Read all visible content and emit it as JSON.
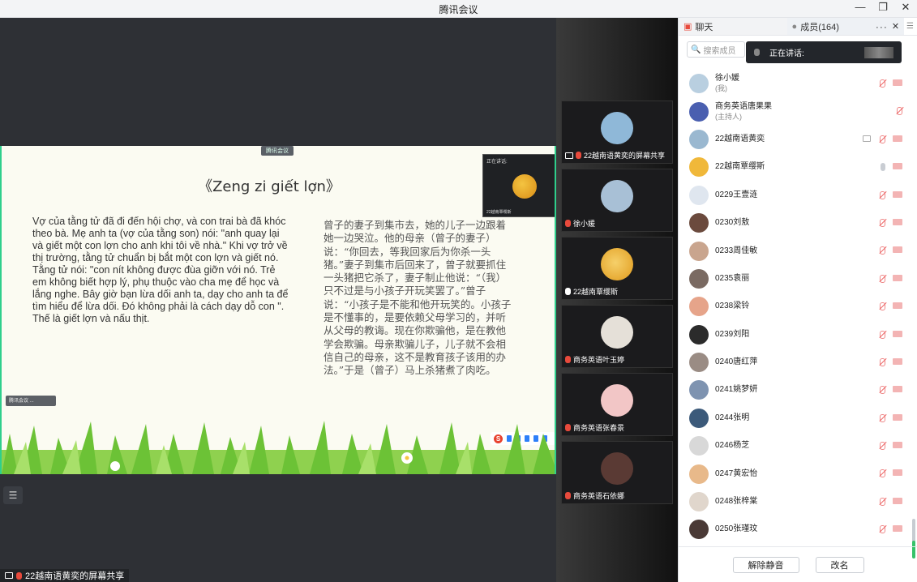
{
  "window": {
    "title": "腾讯会议"
  },
  "slide": {
    "tag": "腾讯会议",
    "title": "《Zeng zi giết lợn》",
    "vietnamese": "  Vợ của tằng tử đã đi đến hội chợ, và con trai bà đã khóc theo bà. Mẹ anh ta (vợ của tằng son) nói: \"anh quay lại và giết một con lợn cho anh khi tôi về nhà.\" Khi vợ trở về thị trường, tằng tử chuẩn bị bắt một con lợn và giết nó.\n  Tằng tử nói: \"con nít không được đùa giỡn với nó. Trẻ em không biết hợp lý, phụ thuộc vào cha mẹ để học và lắng nghe. Bây giờ bạn lừa dối anh ta, dạy cho anh ta để tìm hiểu để lừa dối. Đó không phải là cách dạy dỗ con \". Thế là giết lợn và nấu thịt.",
    "chinese": "曾子的妻子到集市去，她的儿子一边跟着她一边哭泣。他的母亲（曾子的妻子）说：“你回去，等我回家后为你杀一头猪。”妻子到集市后回来了，曾子就要抓住一头猪把它杀了，妻子制止他说：“（我）只不过是与小孩子开玩笑罢了。”曾子说：“小孩子是不能和他开玩笑的。小孩子是不懂事的，是要依赖父母学习的，并听从父母的教诲。现在你欺骗他，是在教他学会欺骗。母亲欺骗儿子，儿子就不会相信自己的母亲，这不是教育孩子该用的办法。”于是（曾子）马上杀猪煮了肉吃。",
    "speaker_label": "正在讲话:",
    "speaker_name": "22越南覃缨斯",
    "toolbar_label": "腾讯会议 ...",
    "ime_label": "S"
  },
  "stage": {
    "share_caption": "22越南语黄奕的屏幕共享"
  },
  "tiles": [
    {
      "caption": "22越南语黄奕的屏幕共享",
      "mic": "off",
      "screen": true,
      "color": "#8fb8d8"
    },
    {
      "caption": "徐小媛",
      "mic": "off",
      "screen": false,
      "color": "#a8c0d6"
    },
    {
      "caption": "22越南覃缨斯",
      "mic": "on",
      "screen": false,
      "color": "#f0b83a"
    },
    {
      "caption": "商务英语叶玉婷",
      "mic": "off",
      "screen": false,
      "color": "#d9d2c8"
    },
    {
      "caption": "商务英语张春景",
      "mic": "off",
      "screen": false,
      "color": "#f2c6c6"
    },
    {
      "caption": "商务英语石依娜",
      "mic": "off",
      "screen": false,
      "color": "#5a3a34"
    }
  ],
  "panel": {
    "chat_tab": "聊天",
    "members_tab": "成员(164)",
    "search_placeholder": "搜索成员",
    "speaking_label": "正在讲话:",
    "members": [
      {
        "name": "徐小媛",
        "sub": "(我)",
        "mic": "off",
        "cam": true,
        "screen": false,
        "color": "#b9cfe0"
      },
      {
        "name": "商务英语唐果果",
        "sub": "(主持人)",
        "mic": "off",
        "cam": false,
        "screen": false,
        "color": "#4a5fb0"
      },
      {
        "name": "22越南语黄奕",
        "sub": "",
        "mic": "off",
        "cam": true,
        "screen": true,
        "color": "#9ab8d0"
      },
      {
        "name": "22越南覃缨斯",
        "sub": "",
        "mic": "on",
        "cam": true,
        "screen": false,
        "color": "#f0b83a"
      },
      {
        "name": "0229王壹涟",
        "sub": "",
        "mic": "off",
        "cam": true,
        "screen": false,
        "color": "#dfe6ef"
      },
      {
        "name": "0230刘敖",
        "sub": "",
        "mic": "off",
        "cam": true,
        "screen": false,
        "color": "#6b4a3d"
      },
      {
        "name": "0233周佳敏",
        "sub": "",
        "mic": "off",
        "cam": true,
        "screen": false,
        "color": "#c9a58e"
      },
      {
        "name": "0235袁丽",
        "sub": "",
        "mic": "off",
        "cam": true,
        "screen": false,
        "color": "#7a6a62"
      },
      {
        "name": "0238梁铃",
        "sub": "",
        "mic": "off",
        "cam": true,
        "screen": false,
        "color": "#e6a48a"
      },
      {
        "name": "0239刘阳",
        "sub": "",
        "mic": "off",
        "cam": true,
        "screen": false,
        "color": "#2b2b2b"
      },
      {
        "name": "0240唐红萍",
        "sub": "",
        "mic": "off",
        "cam": true,
        "screen": false,
        "color": "#9a8c84"
      },
      {
        "name": "0241姚梦妍",
        "sub": "",
        "mic": "off",
        "cam": true,
        "screen": false,
        "color": "#7e93b0"
      },
      {
        "name": "0244张明",
        "sub": "",
        "mic": "off",
        "cam": true,
        "screen": false,
        "color": "#3c5a7a"
      },
      {
        "name": "0246杨芝",
        "sub": "",
        "mic": "off",
        "cam": true,
        "screen": false,
        "color": "#d8d8d8"
      },
      {
        "name": "0247黄宏怡",
        "sub": "",
        "mic": "off",
        "cam": true,
        "screen": false,
        "color": "#e8b98a"
      },
      {
        "name": "0248张梓棠",
        "sub": "",
        "mic": "off",
        "cam": true,
        "screen": false,
        "color": "#e0d6cc"
      },
      {
        "name": "0250张瑾玟",
        "sub": "",
        "mic": "off",
        "cam": true,
        "screen": false,
        "color": "#4a3a36"
      }
    ],
    "unmute_button": "解除静音",
    "rename_button": "改名"
  }
}
